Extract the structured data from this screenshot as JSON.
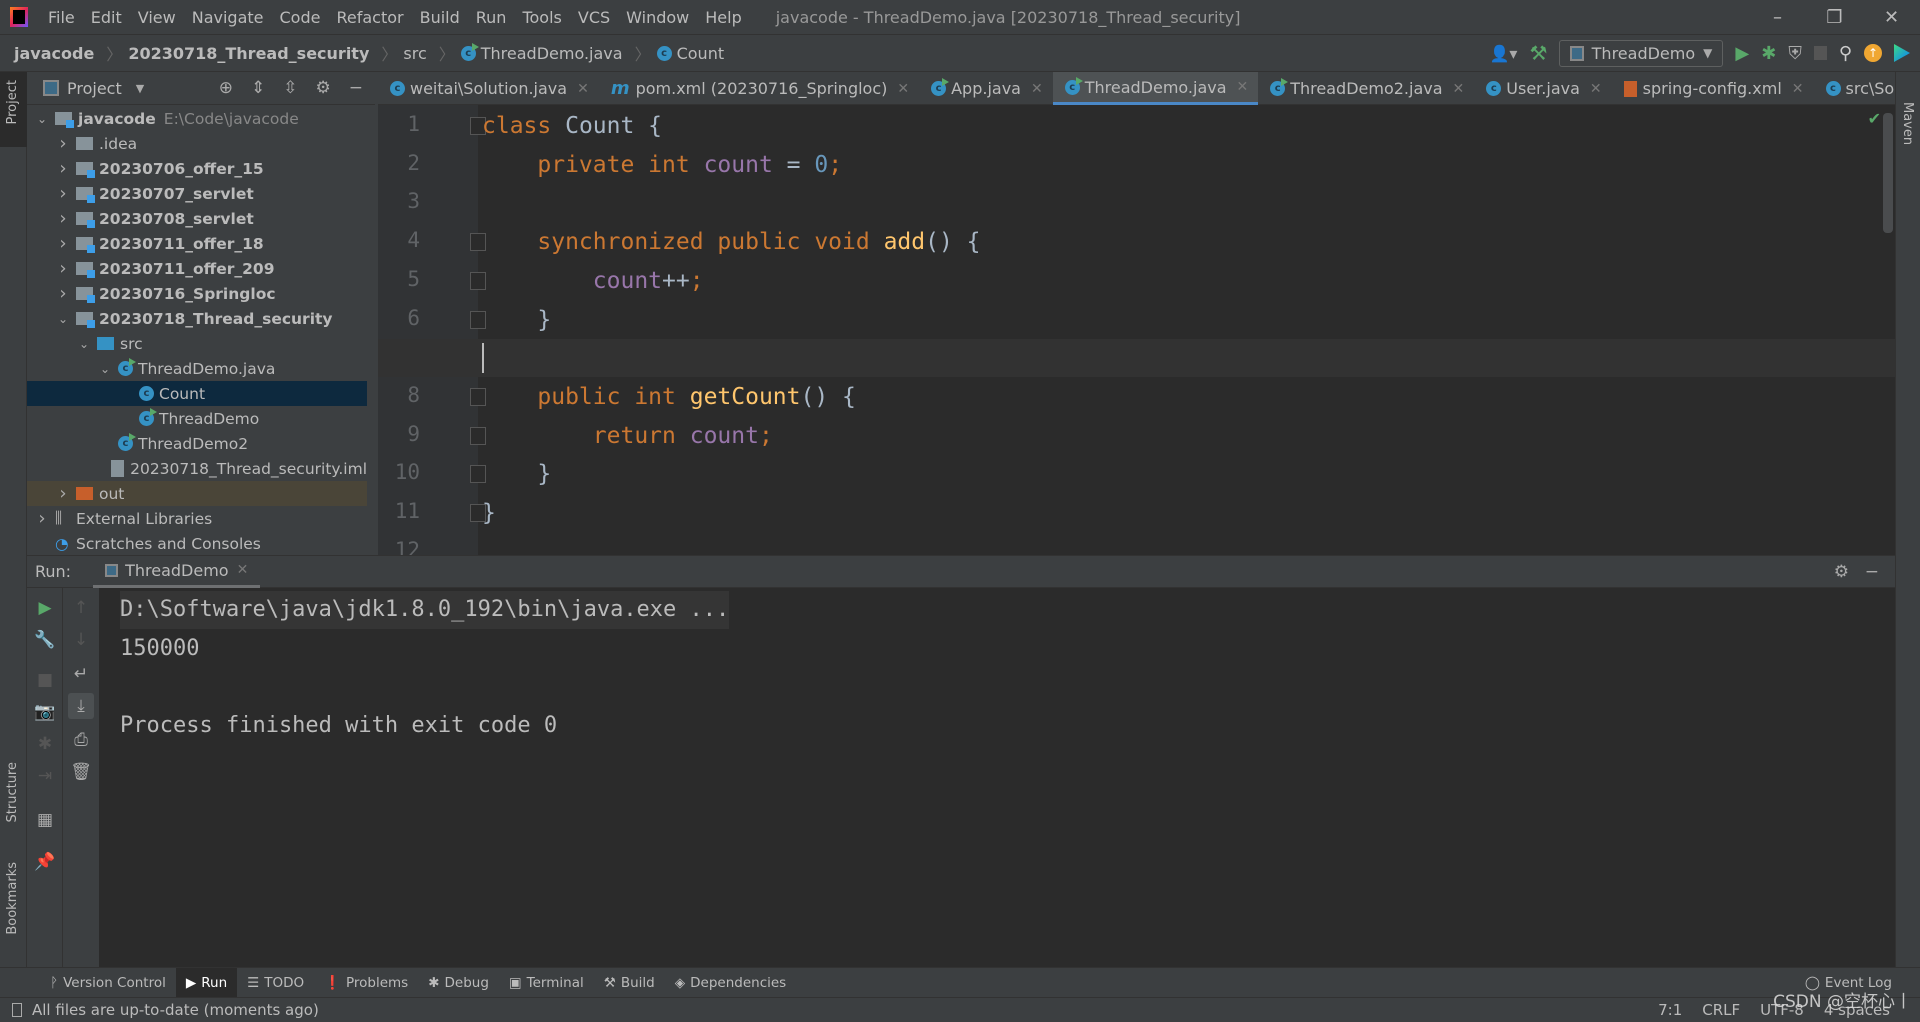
{
  "window": {
    "title": "javacode - ThreadDemo.java [20230718_Thread_security]",
    "minimize": "–",
    "restore": "❐",
    "close": "✕"
  },
  "menu": [
    "File",
    "Edit",
    "View",
    "Navigate",
    "Code",
    "Refactor",
    "Build",
    "Run",
    "Tools",
    "VCS",
    "Window",
    "Help"
  ],
  "breadcrumb": [
    "javacode",
    "20230718_Thread_security",
    "src",
    "ThreadDemo.java",
    "Count"
  ],
  "toolbar": {
    "run_config": "ThreadDemo"
  },
  "project": {
    "title": "Project",
    "tree": [
      {
        "label": "javacode",
        "hint": "E:\\Code\\javacode",
        "level": 0,
        "arrow": "open",
        "icon": "module",
        "bold": true
      },
      {
        "label": ".idea",
        "level": 1,
        "arrow": "closed",
        "icon": "folder"
      },
      {
        "label": "20230706_offer_15",
        "level": 1,
        "arrow": "closed",
        "icon": "module",
        "bold": true
      },
      {
        "label": "20230707_servlet",
        "level": 1,
        "arrow": "closed",
        "icon": "module",
        "bold": true
      },
      {
        "label": "20230708_servlet",
        "level": 1,
        "arrow": "closed",
        "icon": "module",
        "bold": true
      },
      {
        "label": "20230711_offer_18",
        "level": 1,
        "arrow": "closed",
        "icon": "module",
        "bold": true
      },
      {
        "label": "20230711_offer_209",
        "level": 1,
        "arrow": "closed",
        "icon": "module",
        "bold": true
      },
      {
        "label": "20230716_Springloc",
        "level": 1,
        "arrow": "closed",
        "icon": "module",
        "bold": true
      },
      {
        "label": "20230718_Thread_security",
        "level": 1,
        "arrow": "open",
        "icon": "module",
        "bold": true
      },
      {
        "label": "src",
        "level": 2,
        "arrow": "open",
        "icon": "src"
      },
      {
        "label": "ThreadDemo.java",
        "level": 3,
        "arrow": "open",
        "icon": "class-run"
      },
      {
        "label": "Count",
        "level": 4,
        "icon": "class",
        "selected": true
      },
      {
        "label": "ThreadDemo",
        "level": 4,
        "icon": "class-run"
      },
      {
        "label": "ThreadDemo2",
        "level": 3,
        "icon": "class-run"
      },
      {
        "label": "20230718_Thread_security.iml",
        "level": 3,
        "icon": "file"
      },
      {
        "label": "out",
        "level": 1,
        "arrow": "closed",
        "icon": "out",
        "excluded": true
      },
      {
        "label": "External Libraries",
        "level": 0,
        "arrow": "closed",
        "icon": "library"
      },
      {
        "label": "Scratches and Consoles",
        "level": 0,
        "icon": "scratch"
      }
    ]
  },
  "tabs": [
    {
      "label": "weitai\\Solution.java",
      "icon": "class"
    },
    {
      "label": "pom.xml (20230716_Springloc)",
      "icon": "maven"
    },
    {
      "label": "App.java",
      "icon": "class-run"
    },
    {
      "label": "ThreadDemo.java",
      "icon": "class-run",
      "active": true
    },
    {
      "label": "ThreadDemo2.java",
      "icon": "class-run"
    },
    {
      "label": "User.java",
      "icon": "class"
    },
    {
      "label": "spring-config.xml",
      "icon": "xml"
    },
    {
      "label": "src\\Solution",
      "icon": "class"
    }
  ],
  "editor": {
    "current_line": 7,
    "lines": [
      [
        [
          "k",
          "class "
        ],
        [
          "t",
          "Count {"
        ]
      ],
      [
        [
          "t",
          "    "
        ],
        [
          "k",
          "private int "
        ],
        [
          "f",
          "count"
        ],
        [
          "t",
          " = "
        ],
        [
          "n",
          "0"
        ],
        [
          "k",
          ";"
        ]
      ],
      [],
      [
        [
          "t",
          "    "
        ],
        [
          "k",
          "synchronized public void "
        ],
        [
          "m",
          "add"
        ],
        [
          "t",
          "() {"
        ]
      ],
      [
        [
          "t",
          "        "
        ],
        [
          "f",
          "count"
        ],
        [
          "t",
          "++"
        ],
        [
          "k",
          ";"
        ]
      ],
      [
        [
          "t",
          "    }"
        ]
      ],
      [],
      [
        [
          "t",
          "    "
        ],
        [
          "k",
          "public int "
        ],
        [
          "m",
          "getCount"
        ],
        [
          "t",
          "() {"
        ]
      ],
      [
        [
          "t",
          "        "
        ],
        [
          "k",
          "return "
        ],
        [
          "f",
          "count"
        ],
        [
          "k",
          ";"
        ]
      ],
      [
        [
          "t",
          "    }"
        ]
      ],
      [
        [
          "t",
          "}"
        ]
      ],
      []
    ]
  },
  "side": {
    "left_top": "Project",
    "structure": "Structure",
    "bookmarks": "Bookmarks",
    "maven": "Maven"
  },
  "run": {
    "label": "Run:",
    "tab": "ThreadDemo",
    "console": [
      "D:\\Software\\java\\jdk1.8.0_192\\bin\\java.exe ...",
      "150000",
      "",
      "Process finished with exit code 0"
    ]
  },
  "toolwindows": [
    "Version Control",
    "Run",
    "TODO",
    "Problems",
    "Debug",
    "Terminal",
    "Build",
    "Dependencies"
  ],
  "event_log": "Event Log",
  "status": {
    "message": "All files are up-to-date (moments ago)",
    "position": "7:1",
    "line_sep": "CRLF",
    "encoding": "UTF-8",
    "indent": "4 spaces"
  },
  "watermark": "CSDN @空杯心丨",
  "colors": {
    "keyword": "#cc7832",
    "field": "#9876aa",
    "number": "#6897bb",
    "method": "#ffc66d",
    "text": "#a9b7c6",
    "selection": "#0d293e",
    "accent": "#4a88c7"
  }
}
